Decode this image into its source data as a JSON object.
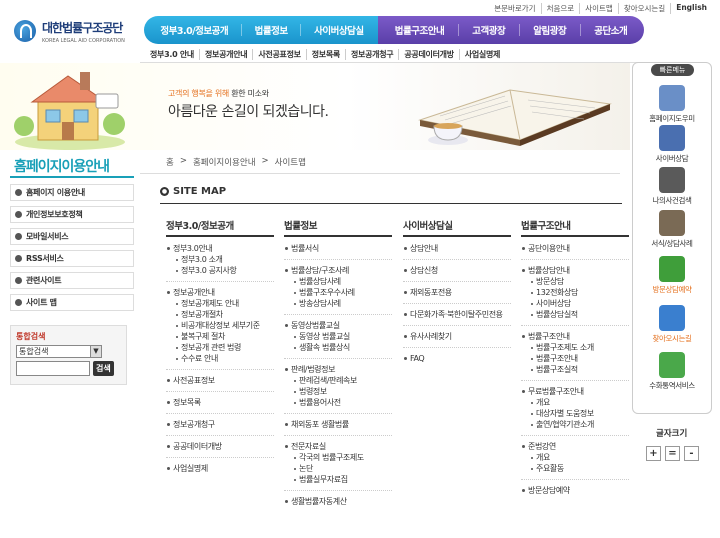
{
  "header": {
    "logo_ko": "대한법률구조공단",
    "logo_en": "KOREA LEGAL AID CORPORATION",
    "top_links": [
      "본문바로가기",
      "처음으로",
      "사이트맵",
      "찾아오시는길",
      "English"
    ],
    "gnb_primary": [
      "정부3.0/정보공개",
      "법률정보",
      "사이버상담실"
    ],
    "gnb_secondary": [
      "법률구조안내",
      "고객광장",
      "알림광장",
      "공단소개"
    ],
    "sub_nav": [
      "정부3.0 안내",
      "정보공개안내",
      "사전공표정보",
      "정보목록",
      "정보공개청구",
      "공공데이터개방",
      "사업실명제"
    ]
  },
  "visual": {
    "slogan_line1_a": "고객의 행복을 위해",
    "slogan_line1_b": "환한 미소와",
    "slogan_line2": "아름다운 손길이 되겠습니다."
  },
  "left": {
    "title_a": "홈페이지",
    "title_b": "이용안내",
    "menu": [
      "홈페이지 이용안내",
      "개인정보보호정책",
      "모바일서비스",
      "RSS서비스",
      "관련사이트",
      "사이트 맵"
    ],
    "search_title": "통합검색",
    "search_select": "통합검색",
    "search_button": "검색"
  },
  "content": {
    "breadcrumb": [
      "홈",
      "홈페이지이용안내",
      "사이트맵"
    ],
    "breadcrumb_sep": ">",
    "title": "SITE MAP",
    "columns": [
      {
        "head": "정부3.0/정보공개",
        "groups": [
          {
            "l1": "정부3.0안내",
            "l2": [
              "정부3.0 소개",
              "정부3.0 공지사항"
            ]
          },
          {
            "l1": "정보공개안내",
            "l2": [
              "정보공개제도 안내",
              "정보공개절차",
              "비공개대상정보 세부기준",
              "불복구제 절차",
              "정보공개 관련 법령",
              "수수료 안내"
            ]
          },
          {
            "l1": "사전공표정보",
            "l2": []
          },
          {
            "l1": "정보목록",
            "l2": []
          },
          {
            "l1": "정보공개청구",
            "l2": []
          },
          {
            "l1": "공공데이터개방",
            "l2": []
          },
          {
            "l1": "사업실명제",
            "l2": []
          }
        ]
      },
      {
        "head": "법률정보",
        "groups": [
          {
            "l1": "법률서식",
            "l2": []
          },
          {
            "l1": "법률상담/구조사례",
            "l2": [
              "법률상담사례",
              "법률구조우수사례",
              "방송상담사례"
            ]
          },
          {
            "l1": "동영상법률교실",
            "l2": [
              "동영상 법률교실",
              "생활속 법률상식"
            ]
          },
          {
            "l1": "판례/법령정보",
            "l2": [
              "판례검색/판례속보",
              "법령정보",
              "법률용어사전"
            ]
          },
          {
            "l1": "채외동포 생활법률",
            "l2": []
          },
          {
            "l1": "전문자료실",
            "l2": [
              "각국의 법률구조제도",
              "논단",
              "법률실무자료집"
            ]
          },
          {
            "l1": "생활법률자동계산",
            "l2": []
          }
        ]
      },
      {
        "head": "사이버상담실",
        "groups": [
          {
            "l1": "상담안내",
            "l2": []
          },
          {
            "l1": "상담신청",
            "l2": []
          },
          {
            "l1": "재외동포전용",
            "l2": []
          },
          {
            "l1": "다문화가족·북한이탈주민전용",
            "l2": []
          },
          {
            "l1": "유사사례찾기",
            "l2": []
          },
          {
            "l1": "FAQ",
            "l2": []
          }
        ]
      },
      {
        "head": "법률구조안내",
        "groups": [
          {
            "l1": "공단이용안내",
            "l2": []
          },
          {
            "l1": "법률상담안내",
            "l2": [
              "방문상담",
              "132전화상담",
              "사이버상담",
              "법률상담실적"
            ]
          },
          {
            "l1": "법률구조안내",
            "l2": [
              "법률구조제도 소개",
              "법률구조안내",
              "법률구조실적"
            ]
          },
          {
            "l1": "무료법률구조안내",
            "l2": [
              "개요",
              "대상자별 도움정보",
              "출연/협약기관소개"
            ]
          },
          {
            "l1": "준법강연",
            "l2": [
              "개요",
              "주요활동"
            ]
          },
          {
            "l1": "방문상담예약",
            "l2": []
          }
        ]
      }
    ]
  },
  "quick": {
    "head": "빠른메뉴",
    "items": [
      {
        "label": "홈페이지도우미",
        "icon": "helper-icon",
        "color": "#6a8fc7"
      },
      {
        "label": "사이버상담",
        "icon": "cyber-counsel-icon",
        "color": "#4a6fb0"
      },
      {
        "label": "나의사건검색",
        "icon": "case-search-icon",
        "color": "#5a5a5a"
      },
      {
        "label": "서식/상담사례",
        "icon": "forms-icon",
        "color": "#7a6a55"
      },
      {
        "label": "방문상담예약",
        "icon": "visit-reservation-icon",
        "color": "#3f9e3a"
      },
      {
        "label": "찾아오시는길",
        "icon": "location-icon",
        "color": "#3a7fcf"
      },
      {
        "label": "수화통역서비스",
        "icon": "sign-language-icon",
        "color": "#4aa84a"
      }
    ],
    "font_size_label": "글자크기",
    "font_buttons": [
      "+",
      "=",
      "-"
    ]
  },
  "colors": {
    "accent_blue": "#1a94cc",
    "accent_purple": "#5a3fa8",
    "teal": "#19a0b8",
    "orange": "#e4701e"
  }
}
